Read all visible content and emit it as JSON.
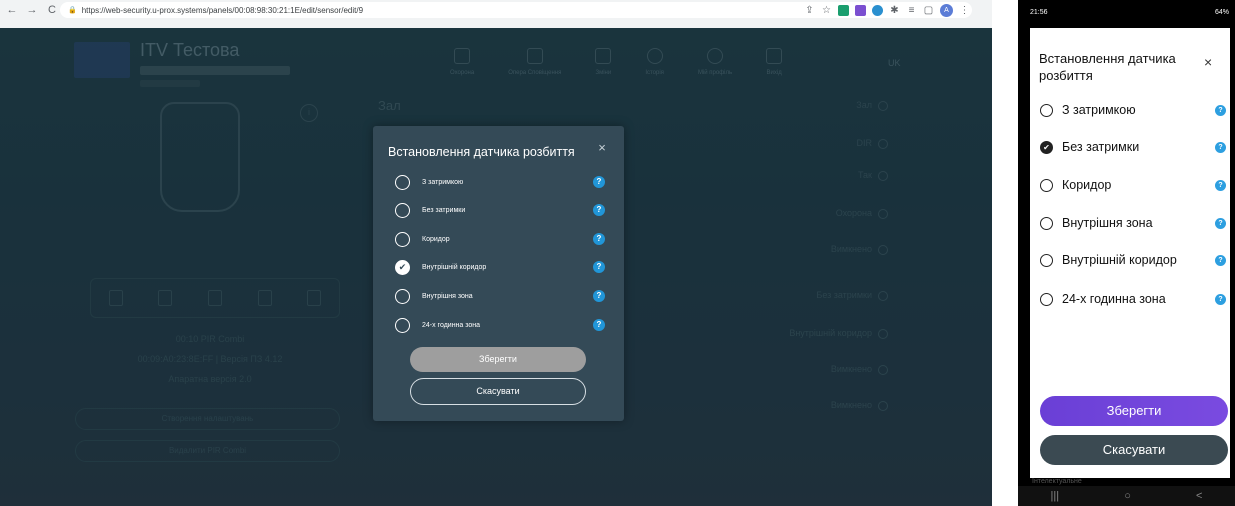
{
  "browser": {
    "url": "https://web-security.u-prox.systems/panels/00:08:98:30:21:1E/edit/sensor/edit/9",
    "nav": {
      "back": "←",
      "forward": "→",
      "reload": "C"
    },
    "extension_icons": [
      "share-icon",
      "star-icon",
      "ext-green-icon",
      "ext-purple-icon",
      "ext-teal-icon",
      "puzzle-icon",
      "menu-list-icon",
      "split-icon"
    ],
    "avatar_initial": "A",
    "menu": "⋮"
  },
  "panel": {
    "title": "ITV Тестова",
    "lang": "UK",
    "nav_items": [
      "Охорона",
      "Опера Сповіщення",
      "Зміни",
      "Історія",
      "Мій профіль",
      "Вихід"
    ],
    "side_label": "Зал",
    "device_lines": [
      "00:10 PIR Combi",
      "00:09:A0:23:8E:FF | Версія ПЗ 4.12",
      "Апаратна версія 2.0"
    ],
    "ghost_buttons": [
      "Створення налаштувань",
      "Видалити PIR Combi"
    ],
    "form_rows": [
      "Зал",
      "DIR",
      "Так",
      "Охорона",
      "Вимкнено",
      "Без затримки",
      "Внутрішній коридор",
      "Вимкнено",
      "Вимкнено"
    ]
  },
  "modal": {
    "title": "Встановлення датчика розбиття",
    "close": "×",
    "options": [
      {
        "label": "З затримкою",
        "checked": false
      },
      {
        "label": "Без затримки",
        "checked": false
      },
      {
        "label": "Коридор",
        "checked": false
      },
      {
        "label": "Внутрішній коридор",
        "checked": true
      },
      {
        "label": "Внутрішня зона",
        "checked": false
      },
      {
        "label": "24-х годинна зона",
        "checked": false
      }
    ],
    "help_glyph": "?",
    "save": "Зберегти",
    "cancel": "Скасувати",
    "colors": {
      "bg": "#344a57",
      "help": "#2196d8",
      "save_disabled": "#9e9e9e"
    }
  },
  "phone": {
    "status_time": "21:56",
    "status_right": "64%",
    "title": "Встановлення датчика розбиття",
    "close": "×",
    "options": [
      {
        "label": "З затримкою",
        "checked": false
      },
      {
        "label": "Без затримки",
        "checked": true
      },
      {
        "label": "Коридор",
        "checked": false
      },
      {
        "label": "Внутрішня зона",
        "checked": false
      },
      {
        "label": "Внутрішній коридор",
        "checked": false
      },
      {
        "label": "24-х годинна зона",
        "checked": false
      }
    ],
    "help_glyph": "?",
    "save": "Зберегти",
    "cancel": "Скасувати",
    "underlay_text": "Інтелектуальне",
    "navbar": [
      "|||",
      "○",
      "<"
    ],
    "colors": {
      "save": "#6a3fd6",
      "cancel": "#3b4a52",
      "help": "#2d9fe0"
    }
  }
}
